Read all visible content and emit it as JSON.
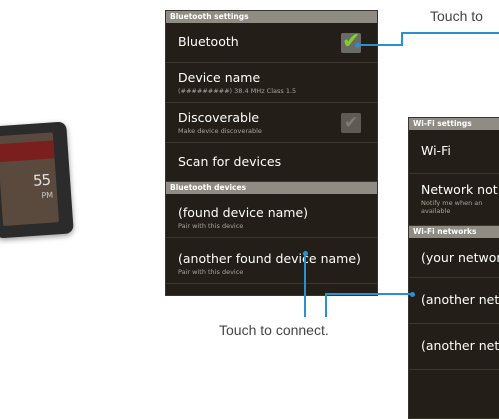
{
  "bluetooth_panel": {
    "header": "Bluetooth settings",
    "bluetooth": {
      "label": "Bluetooth",
      "checked": true
    },
    "device_name": {
      "label": "Device name",
      "sub": "(#########) 38.4 MHz Class 1.5"
    },
    "discoverable": {
      "label": "Discoverable",
      "sub": "Make device discoverable",
      "checked": false
    },
    "scan": {
      "label": "Scan for devices"
    },
    "devices_header": "Bluetooth devices",
    "devices": [
      {
        "label": "(found device name)",
        "sub": "Pair with this device"
      },
      {
        "label": "(another found device name)",
        "sub": "Pair with this device"
      }
    ]
  },
  "wifi_panel": {
    "header": "Wi-Fi settings",
    "wifi": {
      "label": "Wi-Fi"
    },
    "network_notification": {
      "label": "Network not",
      "sub": "Notify me when an",
      "sub2": "available"
    },
    "networks_header": "Wi-Fi networks",
    "networks": [
      {
        "label": "(your networ"
      },
      {
        "label": "(another net"
      },
      {
        "label": "(another net"
      }
    ]
  },
  "device": {
    "clock": "55"
  },
  "callouts": {
    "touch_to_top": "Touch to",
    "touch_to_connect": "Touch to connect."
  },
  "colors": {
    "panel_bg": "#231f18",
    "header_bg": "#8f8c84",
    "accent_blue": "#2a90d0",
    "check_green": "#7fd12a"
  }
}
